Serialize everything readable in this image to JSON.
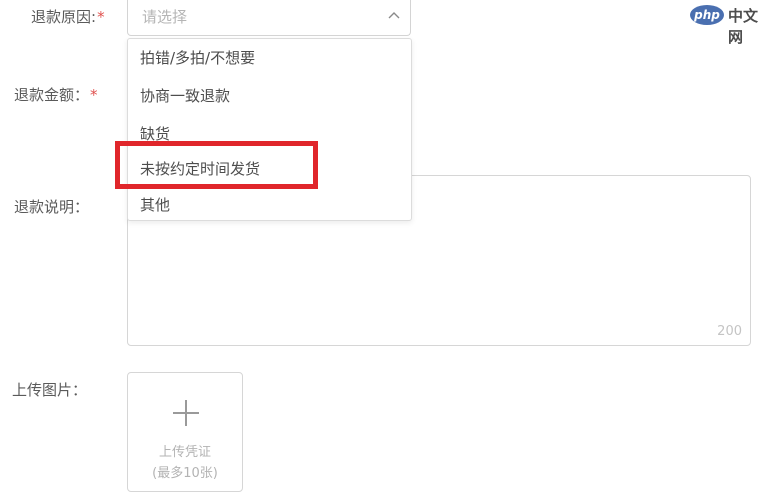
{
  "form": {
    "reason_label": "退款原因:",
    "reason_required": "*",
    "reason_placeholder": "请选择",
    "amount_label": "退款金额：",
    "amount_required": "*",
    "desc_label": "退款说明：",
    "desc_counter": "200",
    "upload_label": "上传图片："
  },
  "dropdown": {
    "options": [
      "拍错/多拍/不想要",
      "协商一致退款",
      "缺货",
      "未按约定时间发货",
      "其他"
    ]
  },
  "upload": {
    "title": "上传凭证",
    "subtitle": "(最多10张)"
  },
  "watermark": {
    "badge": "php",
    "site": "中文网"
  },
  "colors": {
    "required": "#e0524f",
    "highlight": "#e0262b",
    "border": "#d6d6d6"
  }
}
